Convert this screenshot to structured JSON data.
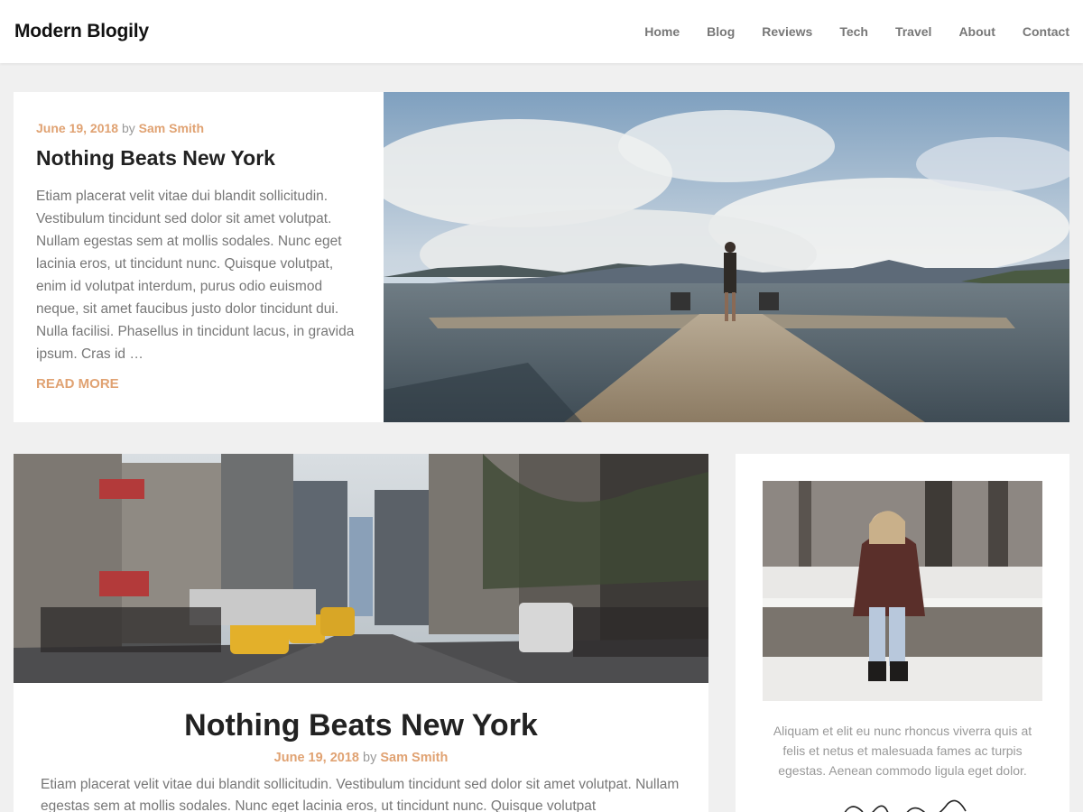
{
  "site": {
    "title": "Modern Blogily"
  },
  "nav": [
    "Home",
    "Blog",
    "Reviews",
    "Tech",
    "Travel",
    "About",
    "Contact"
  ],
  "featured": {
    "date": "June 19, 2018",
    "by": "by",
    "author": "Sam Smith",
    "title": "Nothing Beats New York",
    "excerpt": "Etiam placerat velit vitae dui blandit sollicitudin. Vestibulum tincidunt sed dolor sit amet volutpat. Nullam egestas sem at mollis sodales. Nunc eget lacinia eros, ut tincidunt nunc. Quisque volutpat, enim id volutpat interdum, purus odio euismod neque, sit amet faucibus justo dolor tincidunt dui. Nulla facilisi. Phasellus in tincidunt lacus, in gravida ipsum. Cras id …",
    "read_more": "READ MORE"
  },
  "post": {
    "title": "Nothing Beats New York",
    "date": "June 19, 2018",
    "by": "by",
    "author": "Sam Smith",
    "excerpt": "Etiam placerat velit vitae dui blandit sollicitudin. Vestibulum tincidunt sed dolor sit amet volutpat. Nullam egestas sem at mollis sodales. Nunc eget lacinia eros, ut tincidunt nunc. Quisque volutpat"
  },
  "sidebar": {
    "about_text": "Aliquam et elit eu nunc rhoncus viverra quis at felis et netus et malesuada fames ac turpis egestas. Aenean commodo ligula eget dolor."
  },
  "colors": {
    "accent": "#e0a272",
    "background": "#f0f0f0",
    "text": "#222222",
    "muted": "#777777"
  }
}
